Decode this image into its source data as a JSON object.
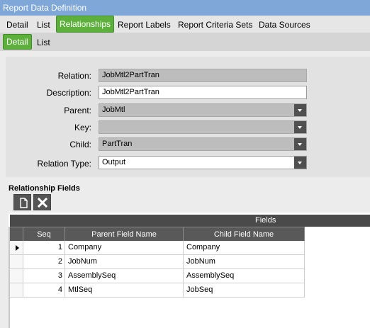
{
  "window": {
    "title": "Report Data Definition"
  },
  "main_tabs": [
    {
      "label": "Detail",
      "active": false
    },
    {
      "label": "List",
      "active": false
    },
    {
      "label": "Relationships",
      "active": true
    },
    {
      "label": "Report Labels",
      "active": false
    },
    {
      "label": "Report Criteria Sets",
      "active": false
    },
    {
      "label": "Data Sources",
      "active": false
    }
  ],
  "sub_tabs": [
    {
      "label": "Detail",
      "active": true
    },
    {
      "label": "List",
      "active": false
    }
  ],
  "form": {
    "relation": {
      "label": "Relation:",
      "value": "JobMtl2PartTran",
      "readonly": true
    },
    "description": {
      "label": "Description:",
      "value": "JobMtl2PartTran"
    },
    "parent": {
      "label": "Parent:",
      "value": "JobMtl"
    },
    "key": {
      "label": "Key:",
      "value": ""
    },
    "child": {
      "label": "Child:",
      "value": "PartTran"
    },
    "relation_type": {
      "label": "Relation Type:",
      "value": "Output"
    }
  },
  "grid": {
    "title": "Relationship Fields",
    "toolbar": {
      "new_icon": "new-page-icon",
      "delete_icon": "delete-x-icon"
    },
    "group_header": "Fields",
    "columns": [
      "Seq",
      "Parent Field Name",
      "Child Field Name"
    ],
    "rows": [
      {
        "seq": "1",
        "parent": "Company",
        "child": "Company"
      },
      {
        "seq": "2",
        "parent": "JobNum",
        "child": "JobNum"
      },
      {
        "seq": "3",
        "parent": "AssemblySeq",
        "child": "AssemblySeq"
      },
      {
        "seq": "4",
        "parent": "MtlSeq",
        "child": "JobSeq"
      }
    ]
  },
  "colors": {
    "accent_tab": "#5cb03b",
    "title_bar": "#7fa7d8",
    "grid_header": "#595959"
  }
}
